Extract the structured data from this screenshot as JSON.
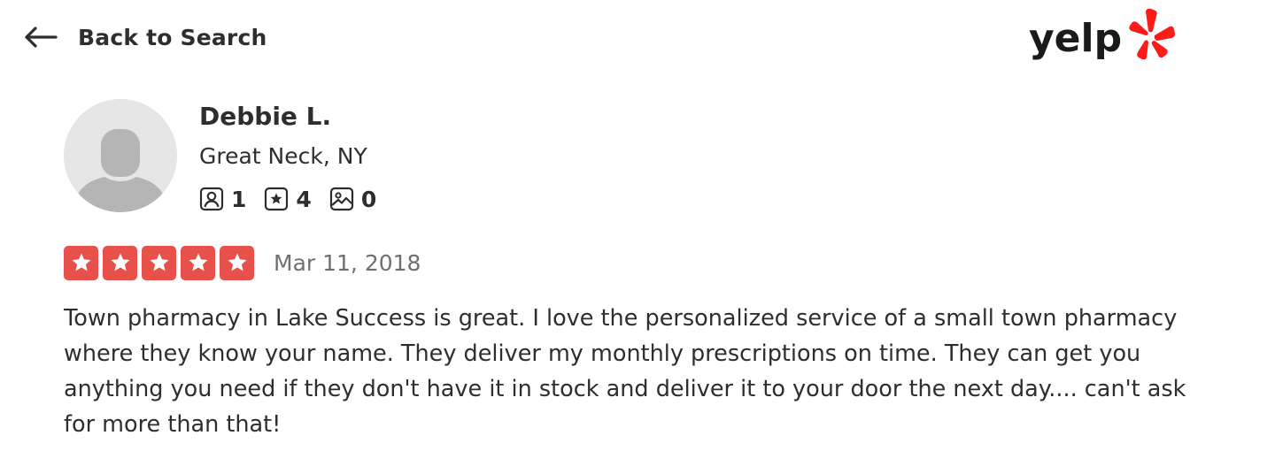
{
  "header": {
    "back_label": "Back to Search",
    "back_icon": "left-arrow-icon",
    "logo_text": "yelp",
    "logo_icon": "yelp-burst-icon",
    "brand_color": "#ff1a1a"
  },
  "reviewer": {
    "name": "Debbie L.",
    "location": "Great Neck, NY",
    "avatar_icon": "default-user-avatar",
    "stats": [
      {
        "icon": "friends-icon",
        "count": "1"
      },
      {
        "icon": "reviews-icon",
        "count": "4"
      },
      {
        "icon": "photos-icon",
        "count": "0"
      }
    ]
  },
  "review": {
    "rating": 5,
    "rating_max": 5,
    "star_color": "#e8504a",
    "date": "Mar 11, 2018",
    "text": "Town pharmacy in Lake Success is great. I love the personalized service of a small town pharmacy where they know your name. They deliver my monthly prescriptions on time. They can get you anything you need if they don't have it in stock and deliver it to your door the next day.... can't ask for more than that!"
  }
}
